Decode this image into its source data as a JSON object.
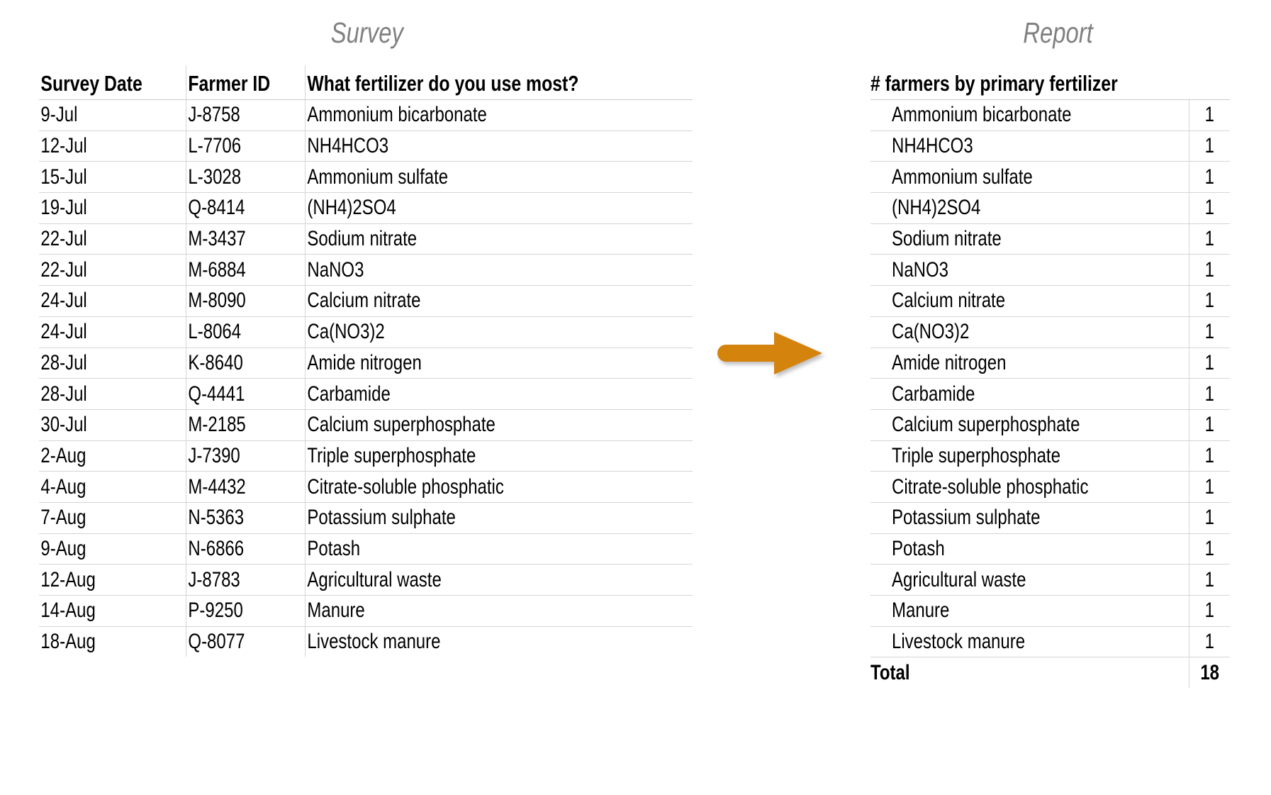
{
  "panels": {
    "survey_title": "Survey",
    "report_title": "Report"
  },
  "arrow": {
    "name": "flow-arrow",
    "color": "#D4830F",
    "direction": "right"
  },
  "survey": {
    "columns": [
      "Survey Date",
      "Farmer ID",
      "What fertilizer do you use most?"
    ],
    "rows": [
      {
        "date": "9-Jul",
        "farmer_id": "J-8758",
        "fertilizer": "Ammonium bicarbonate"
      },
      {
        "date": "12-Jul",
        "farmer_id": "L-7706",
        "fertilizer": "NH4HCO3"
      },
      {
        "date": "15-Jul",
        "farmer_id": "L-3028",
        "fertilizer": "Ammonium sulfate"
      },
      {
        "date": "19-Jul",
        "farmer_id": "Q-8414",
        "fertilizer": "(NH4)2SO4"
      },
      {
        "date": "22-Jul",
        "farmer_id": "M-3437",
        "fertilizer": "Sodium nitrate"
      },
      {
        "date": "22-Jul",
        "farmer_id": "M-6884",
        "fertilizer": "NaNO3"
      },
      {
        "date": "24-Jul",
        "farmer_id": "M-8090",
        "fertilizer": "Calcium nitrate"
      },
      {
        "date": "24-Jul",
        "farmer_id": "L-8064",
        "fertilizer": "Ca(NO3)2"
      },
      {
        "date": "28-Jul",
        "farmer_id": "K-8640",
        "fertilizer": "Amide nitrogen"
      },
      {
        "date": "28-Jul",
        "farmer_id": "Q-4441",
        "fertilizer": "Carbamide"
      },
      {
        "date": "30-Jul",
        "farmer_id": "M-2185",
        "fertilizer": "Calcium superphosphate"
      },
      {
        "date": "2-Aug",
        "farmer_id": "J-7390",
        "fertilizer": "Triple superphosphate"
      },
      {
        "date": "4-Aug",
        "farmer_id": "M-4432",
        "fertilizer": "Citrate-soluble phosphatic"
      },
      {
        "date": "7-Aug",
        "farmer_id": "N-5363",
        "fertilizer": "Potassium sulphate"
      },
      {
        "date": "9-Aug",
        "farmer_id": "N-6866",
        "fertilizer": "Potash"
      },
      {
        "date": "12-Aug",
        "farmer_id": "J-8783",
        "fertilizer": "Agricultural waste"
      },
      {
        "date": "14-Aug",
        "farmer_id": "P-9250",
        "fertilizer": "Manure"
      },
      {
        "date": "18-Aug",
        "farmer_id": "Q-8077",
        "fertilizer": "Livestock manure"
      }
    ]
  },
  "report": {
    "header": "# farmers by primary fertilizer",
    "rows": [
      {
        "label": "Ammonium bicarbonate",
        "count": "1"
      },
      {
        "label": "NH4HCO3",
        "count": "1"
      },
      {
        "label": "Ammonium sulfate",
        "count": "1"
      },
      {
        "label": "(NH4)2SO4",
        "count": "1"
      },
      {
        "label": "Sodium nitrate",
        "count": "1"
      },
      {
        "label": "NaNO3",
        "count": "1"
      },
      {
        "label": "Calcium nitrate",
        "count": "1"
      },
      {
        "label": "Ca(NO3)2",
        "count": "1"
      },
      {
        "label": "Amide nitrogen",
        "count": "1"
      },
      {
        "label": "Carbamide",
        "count": "1"
      },
      {
        "label": "Calcium superphosphate",
        "count": "1"
      },
      {
        "label": "Triple superphosphate",
        "count": "1"
      },
      {
        "label": "Citrate-soluble phosphatic",
        "count": "1"
      },
      {
        "label": "Potassium sulphate",
        "count": "1"
      },
      {
        "label": "Potash",
        "count": "1"
      },
      {
        "label": "Agricultural waste",
        "count": "1"
      },
      {
        "label": "Manure",
        "count": "1"
      },
      {
        "label": "Livestock manure",
        "count": "1"
      }
    ],
    "total_label": "Total",
    "total_count": "18"
  }
}
